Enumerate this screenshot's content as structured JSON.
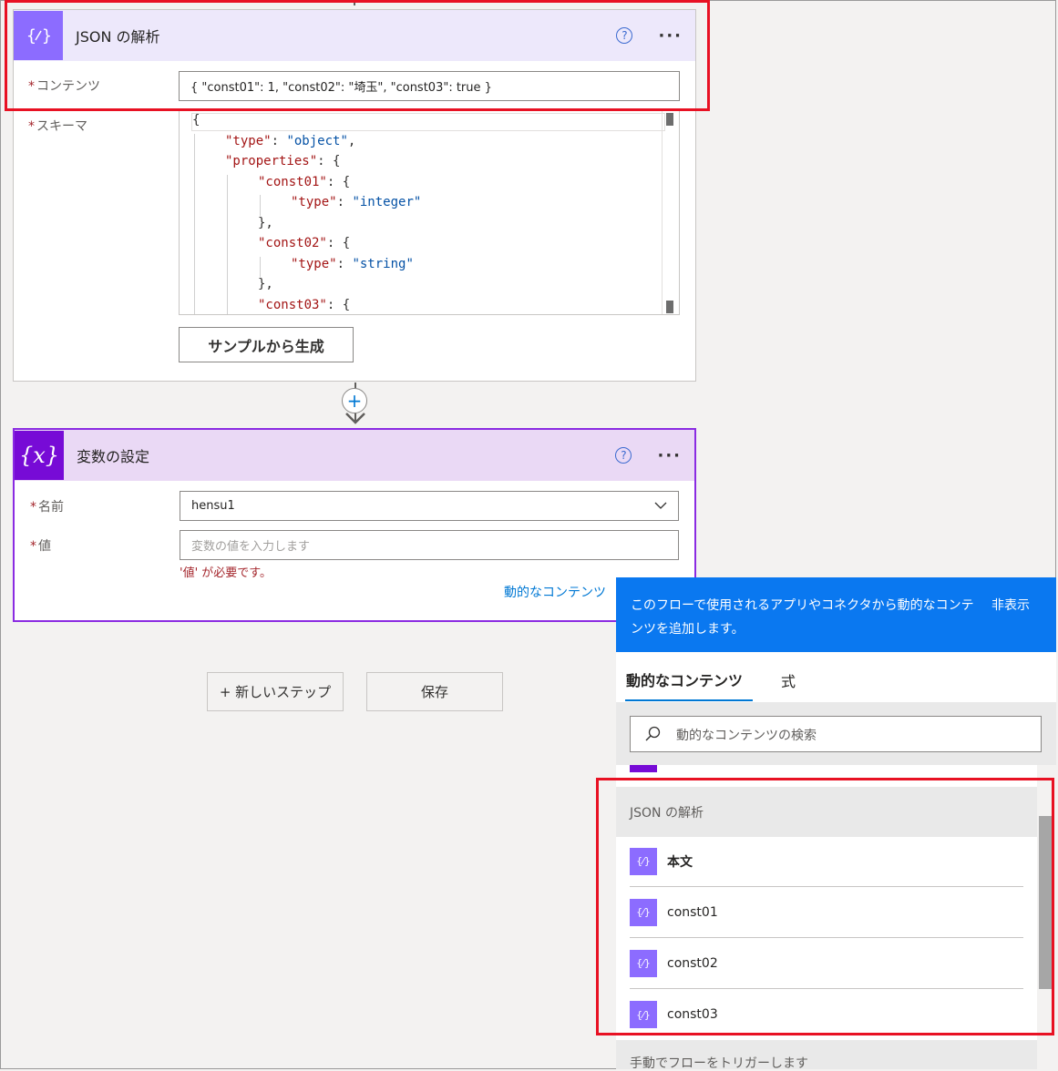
{
  "parse_card": {
    "title": "JSON の解析",
    "help_glyph": "?",
    "more_glyph": "···",
    "content_label": "コンテンツ",
    "content_value": "{ \"const01\": 1, \"const02\": \"埼玉\", \"const03\": true  }",
    "schema_label": "スキーマ",
    "schema_lines": [
      {
        "indent": 0,
        "key": "",
        "rest": "{"
      },
      {
        "indent": 1,
        "key": "\"type\"",
        "rest": ": ",
        "str": "\"object\"",
        "tail": ","
      },
      {
        "indent": 1,
        "key": "\"properties\"",
        "rest": ": {"
      },
      {
        "indent": 2,
        "key": "\"const01\"",
        "rest": ": {"
      },
      {
        "indent": 3,
        "key": "\"type\"",
        "rest": ": ",
        "str": "\"integer\""
      },
      {
        "indent": 2,
        "key": "",
        "rest": "},"
      },
      {
        "indent": 2,
        "key": "\"const02\"",
        "rest": ": {"
      },
      {
        "indent": 3,
        "key": "\"type\"",
        "rest": ": ",
        "str": "\"string\""
      },
      {
        "indent": 2,
        "key": "",
        "rest": "},"
      },
      {
        "indent": 2,
        "key": "\"const03\"",
        "rest": ": {"
      }
    ],
    "generate_label": "サンプルから生成"
  },
  "add_glyph": "+",
  "var_card": {
    "title": "変数の設定",
    "name_label": "名前",
    "name_value": "hensu1",
    "value_label": "値",
    "value_placeholder": "変数の値を入力します",
    "error": "'値' が必要です。",
    "dynamic_link": "動的なコンテンツ"
  },
  "new_step_label": "+ 新しいステップ",
  "save_label": "保存",
  "panel": {
    "info": "このフローで使用されるアプリやコネクタから動的なコンテンツを追加します。",
    "hide_label": "非表示",
    "tabs": [
      "動的なコンテンツ",
      "式"
    ],
    "search_placeholder": "動的なコンテンツの検索",
    "group_title": "JSON の解析",
    "items": [
      "本文",
      "const01",
      "const02",
      "const03"
    ],
    "next_group": "手動でフローをトリガーします"
  },
  "colors": {
    "parse_header": "#ede8fb",
    "parse_icon": "#8c6cff",
    "var_header": "#ead9f5",
    "var_icon": "#770bd6",
    "panel_blue": "#0a78f0",
    "highlight": "#e81123"
  }
}
